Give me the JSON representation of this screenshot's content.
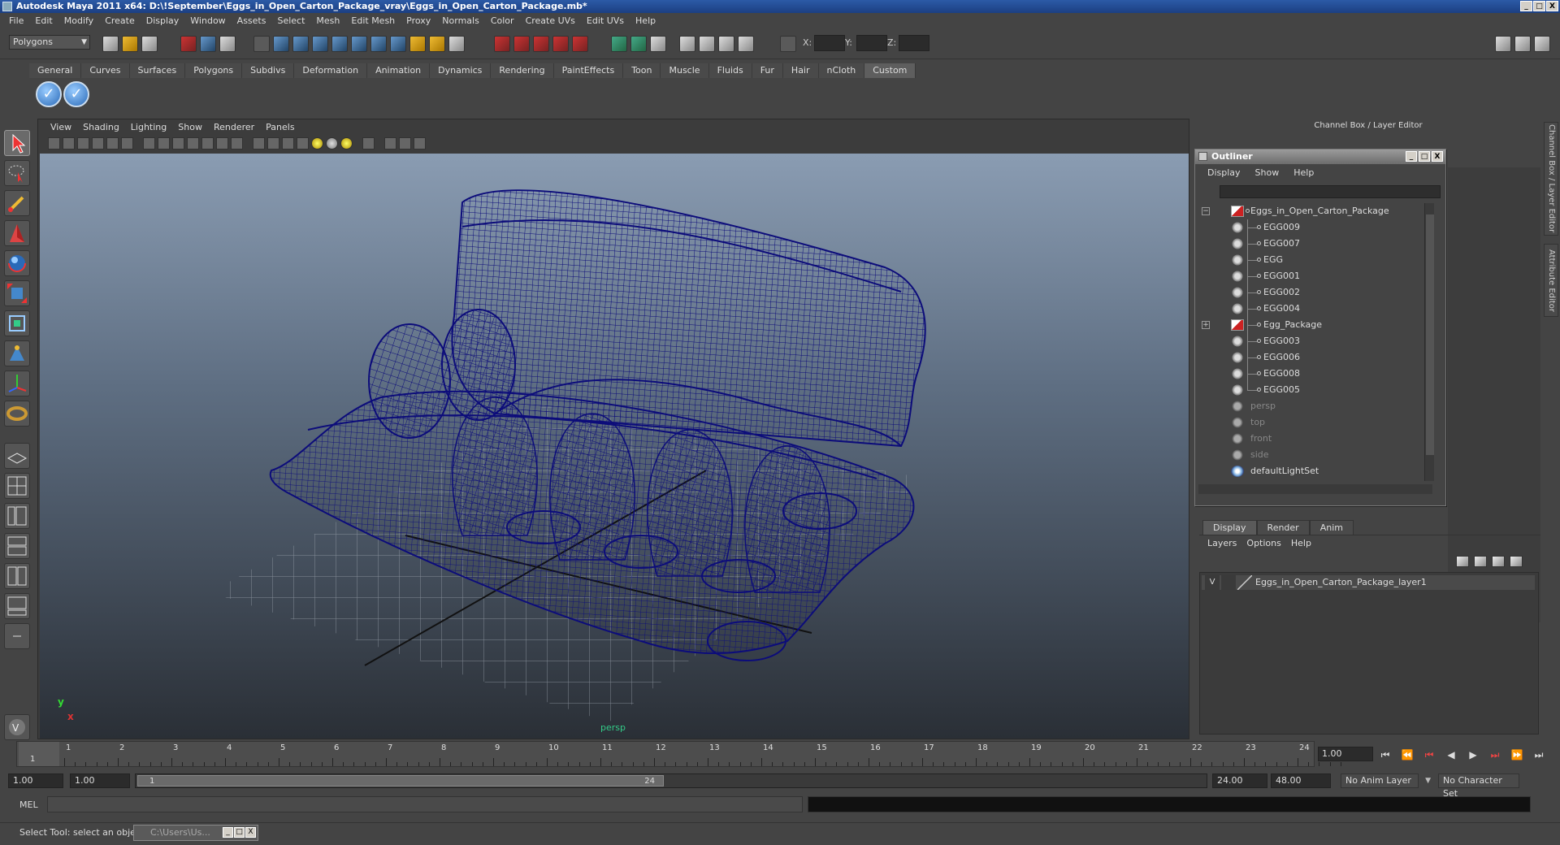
{
  "window": {
    "title": "Autodesk Maya 2011 x64: D:\\!September\\Eggs_in_Open_Carton_Package_vray\\Eggs_in_Open_Carton_Package.mb*",
    "min": "_",
    "max": "□",
    "close": "X"
  },
  "menubar": [
    "File",
    "Edit",
    "Modify",
    "Create",
    "Display",
    "Window",
    "Assets",
    "Select",
    "Mesh",
    "Edit Mesh",
    "Proxy",
    "Normals",
    "Color",
    "Create UVs",
    "Edit UVs",
    "Help"
  ],
  "statusline": {
    "mode": "Polygons",
    "x_label": "X:",
    "y_label": "Y:",
    "z_label": "Z:"
  },
  "shelf": {
    "tabs": [
      "General",
      "Curves",
      "Surfaces",
      "Polygons",
      "Subdivs",
      "Deformation",
      "Animation",
      "Dynamics",
      "Rendering",
      "PaintEffects",
      "Toon",
      "Muscle",
      "Fluids",
      "Fur",
      "Hair",
      "nCloth",
      "Custom"
    ],
    "active_tab": "Custom"
  },
  "viewport": {
    "menu": [
      "View",
      "Shading",
      "Lighting",
      "Show",
      "Renderer",
      "Panels"
    ],
    "camera_label": "persp",
    "axis_x": "x",
    "axis_y": "y",
    "wire_color": "#0c0c7a"
  },
  "channel_box": {
    "title": "Channel Box / Layer Editor",
    "side_tabs": [
      "Channel Box / Layer Editor",
      "Attribute Editor"
    ]
  },
  "outliner": {
    "title": "Outliner",
    "menu": [
      "Display",
      "Show",
      "Help"
    ],
    "items": [
      {
        "label": "Eggs_in_Open_Carton_Package",
        "kind": "group",
        "expander": "−"
      },
      {
        "label": "EGG009",
        "kind": "mesh"
      },
      {
        "label": "EGG007",
        "kind": "mesh"
      },
      {
        "label": "EGG",
        "kind": "mesh"
      },
      {
        "label": "EGG001",
        "kind": "mesh"
      },
      {
        "label": "EGG002",
        "kind": "mesh"
      },
      {
        "label": "EGG004",
        "kind": "mesh"
      },
      {
        "label": "Egg_Package",
        "kind": "group",
        "expander": "+"
      },
      {
        "label": "EGG003",
        "kind": "mesh"
      },
      {
        "label": "EGG006",
        "kind": "mesh"
      },
      {
        "label": "EGG008",
        "kind": "mesh"
      },
      {
        "label": "EGG005",
        "kind": "mesh"
      },
      {
        "label": "persp",
        "kind": "cam"
      },
      {
        "label": "top",
        "kind": "cam"
      },
      {
        "label": "front",
        "kind": "cam"
      },
      {
        "label": "side",
        "kind": "cam"
      },
      {
        "label": "defaultLightSet",
        "kind": "light"
      }
    ]
  },
  "layer_editor": {
    "tabs": [
      "Display",
      "Render",
      "Anim"
    ],
    "active_tab": "Display",
    "menu": [
      "Layers",
      "Options",
      "Help"
    ],
    "layers": [
      {
        "visible": "V",
        "name": "Eggs_in_Open_Carton_Package_layer1"
      }
    ]
  },
  "timeline": {
    "ticks": [
      "1",
      "2",
      "3",
      "4",
      "5",
      "6",
      "7",
      "8",
      "9",
      "10",
      "11",
      "12",
      "13",
      "14",
      "15",
      "16",
      "17",
      "18",
      "19",
      "20",
      "21",
      "22",
      "23",
      "24"
    ],
    "current_marker": "1",
    "current_frame": "1.00",
    "playback": [
      "⏮",
      "⏴⏴",
      "⏮",
      "◀",
      "▶",
      "⏭",
      "⏵⏵",
      "⏭"
    ]
  },
  "range": {
    "start": "1.00",
    "anim_start": "1.00",
    "thumb_start": "1",
    "thumb_end": "24",
    "anim_end": "24.00",
    "end": "48.00",
    "anim_layer": "No Anim Layer",
    "character_set": "No Character Set"
  },
  "command_line": {
    "label": "MEL"
  },
  "help_line": {
    "text": "Select Tool: select an object",
    "task": "C:\\Users\\Us..."
  }
}
